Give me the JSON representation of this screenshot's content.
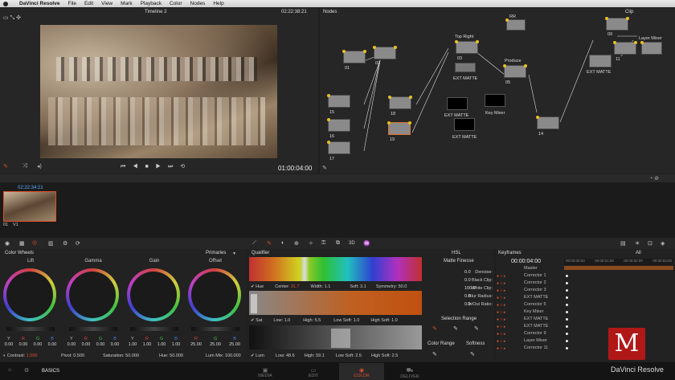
{
  "menu": {
    "app": "DaVinci Resolve",
    "items": [
      "File",
      "Edit",
      "View",
      "Mark",
      "Playback",
      "Color",
      "Nodes",
      "Help"
    ]
  },
  "viewer": {
    "title": "Timeline 2",
    "timecode_top": "02:22:38:21",
    "timecode_bottom": "01:00:04:00"
  },
  "nodes": {
    "title": "Nodes",
    "clip_label": "Clip",
    "list": [
      {
        "id": "01",
        "label": ""
      },
      {
        "id": "02",
        "label": ""
      },
      {
        "id": "15",
        "label": ""
      },
      {
        "id": "16",
        "label": ""
      },
      {
        "id": "17",
        "label": ""
      },
      {
        "id": "18",
        "label": ""
      },
      {
        "id": "19",
        "label": ""
      },
      {
        "id": "03",
        "label": "Top Right"
      },
      {
        "id": "05",
        "label": "Produce"
      },
      {
        "id": "14",
        "label": ""
      },
      {
        "id": "09",
        "label": ""
      },
      {
        "id": "11",
        "label": ""
      },
      {
        "id": "",
        "label": "Layer Mixer"
      },
      {
        "id": "",
        "label": "RR"
      }
    ],
    "mattes": [
      "EXT MATTE",
      "EXT MATTE",
      "EXT MATTE",
      "EXT MATTE"
    ],
    "key_mixer": "Key Mixer"
  },
  "timeline": {
    "clip_timecode": "02:22:34:21",
    "clip_id": "01",
    "track": "V1"
  },
  "color_wheels": {
    "title": "Color Wheels",
    "mode": "Primaries",
    "wheels": [
      {
        "name": "Lift",
        "values": [
          "0.00",
          "0.00",
          "0.00",
          "0.00"
        ]
      },
      {
        "name": "Gamma",
        "values": [
          "0.00",
          "0.00",
          "0.00",
          "0.00"
        ]
      },
      {
        "name": "Gain",
        "values": [
          "1.00",
          "1.00",
          "1.00",
          "1.00"
        ]
      },
      {
        "name": "Offset",
        "values": [
          "25.00",
          "25.00",
          "25.00"
        ]
      }
    ],
    "channel_letters": [
      "Y",
      "R",
      "G",
      "B"
    ],
    "offset_letters": [
      "R",
      "G",
      "B"
    ],
    "contrast_label": "Contrast:",
    "contrast": "1.000",
    "pivot_label": "Pivot:",
    "pivot": "0.500",
    "saturation_label": "Saturation:",
    "saturation": "50.000",
    "hue_label": "Hue:",
    "hue": "50.000",
    "lummix_label": "Lum Mix:",
    "lummix": "100.000"
  },
  "qualifier": {
    "title": "Qualifier",
    "hsl": "HSL",
    "hue": {
      "label": "Hue",
      "center_label": "Center:",
      "center": "31.7",
      "width_label": "Width:",
      "width": "1.1",
      "soft_label": "Soft:",
      "soft": "3.1",
      "symmetry_label": "Symmetry:",
      "symmetry": "50.0"
    },
    "sat": {
      "label": "Sat",
      "low_label": "Low:",
      "low": "1.0",
      "high_label": "High:",
      "high": "5.5",
      "lowsoft_label": "Low Soft:",
      "lowsoft": "1.0",
      "highsoft_label": "High Soft:",
      "highsoft": "1.0"
    },
    "lum": {
      "label": "Lum",
      "low_label": "Low:",
      "low": "48.6",
      "high_label": "High:",
      "high": "59.1",
      "lowsoft_label": "Low Soft:",
      "lowsoft": "2.5",
      "highsoft_label": "High Soft:",
      "highsoft": "2.5"
    },
    "matte_finesse": "Matte Finesse",
    "finesse": [
      {
        "label": "Denoise:",
        "value": "0.0"
      },
      {
        "label": "Black Clip:",
        "value": "0.0"
      },
      {
        "label": "White Clip:",
        "value": "100.0"
      },
      {
        "label": "Blur Radius:",
        "value": "0.0"
      },
      {
        "label": "In/Out Ratio:",
        "value": "0.0"
      }
    ],
    "selection_range": "Selection Range",
    "color_range": "Color Range",
    "softness": "Softness"
  },
  "keyframes": {
    "title": "Keyframes",
    "filter": "All",
    "timecode": "00:00:04:00",
    "ruler": [
      "00:00:00:00",
      "00:00:01:00",
      "00:00:02:00",
      "00:00:03:00"
    ],
    "rows": [
      "Master",
      "Corrector 1",
      "Corrector 2",
      "Corrector 3",
      "EXT MATTE",
      "Corrector 5",
      "Key Mixer",
      "EXT MATTE",
      "EXT MATTE",
      "Corrector 9",
      "Layer Mixer",
      "Corrector 11"
    ]
  },
  "bottom": {
    "basics": "BASICS",
    "tabs": [
      "MEDIA",
      "EDIT",
      "COLOR",
      "DELIVER"
    ],
    "brand": "DaVinci Resolve"
  },
  "colors": {
    "accent": "#e0502a",
    "node_dot": "#e8c020",
    "selected_tab": "#e0502a"
  }
}
